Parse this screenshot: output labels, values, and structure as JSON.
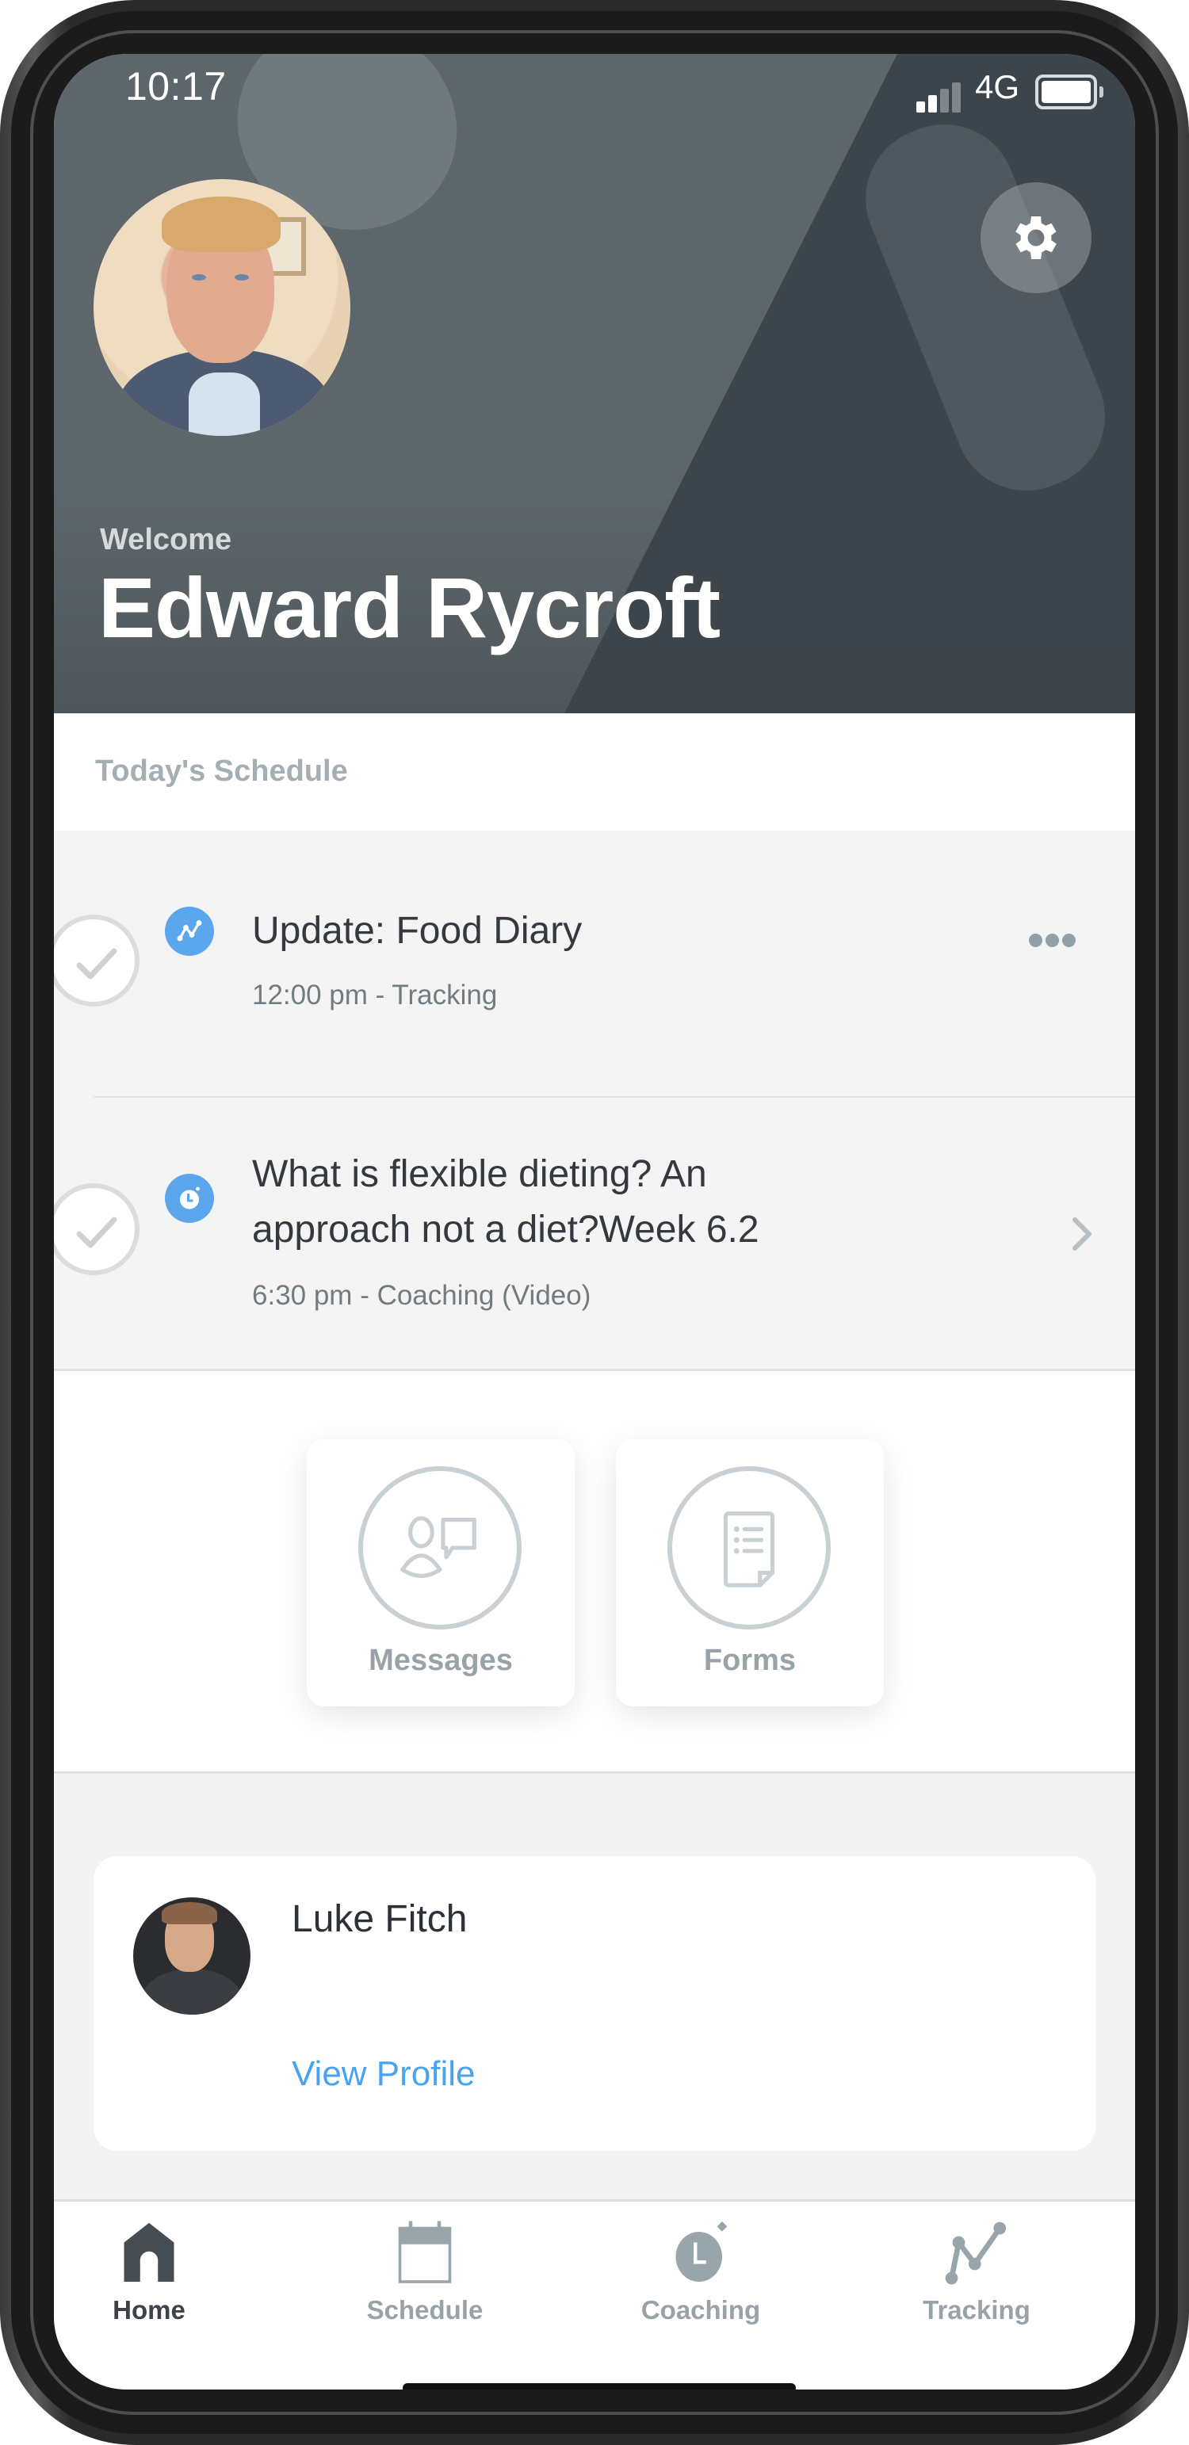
{
  "status_bar": {
    "time": "10:17",
    "network": "4G",
    "signal_bars_filled": 2,
    "signal_bars_total": 4,
    "battery_icon": "battery-full-icon"
  },
  "header": {
    "welcome_label": "Welcome",
    "user_name": "Edward Rycroft",
    "settings_icon": "gear-icon"
  },
  "schedule": {
    "title": "Today's Schedule",
    "items": [
      {
        "title": "Update: Food Diary",
        "subtitle": "12:00 pm - Tracking",
        "badge_icon": "tracking-icon",
        "action_icon": "more-icon",
        "completed": false
      },
      {
        "title_line1": "What is flexible dieting? An",
        "title_line2": "approach not a diet?Week 6.2",
        "subtitle": "6:30 pm - Coaching (Video)",
        "badge_icon": "stopwatch-icon",
        "action_icon": "chevron-right-icon",
        "completed": false
      }
    ]
  },
  "quick_actions": [
    {
      "label": "Messages",
      "icon": "messages-icon"
    },
    {
      "label": "Forms",
      "icon": "forms-icon"
    }
  ],
  "coach": {
    "name": "Luke Fitch",
    "link_label": "View Profile"
  },
  "tabs": [
    {
      "label": "Home",
      "icon": "home-icon",
      "active": true
    },
    {
      "label": "Schedule",
      "icon": "calendar-icon",
      "active": false
    },
    {
      "label": "Coaching",
      "icon": "stopwatch-icon",
      "active": false
    },
    {
      "label": "Tracking",
      "icon": "tracking-icon",
      "active": false
    }
  ],
  "colors": {
    "accent_blue": "#5ba6ec",
    "link_blue": "#4aa3ee",
    "header_bg": "#5d666a",
    "muted_text": "#98a3a9",
    "active_tab": "#3c4247"
  }
}
